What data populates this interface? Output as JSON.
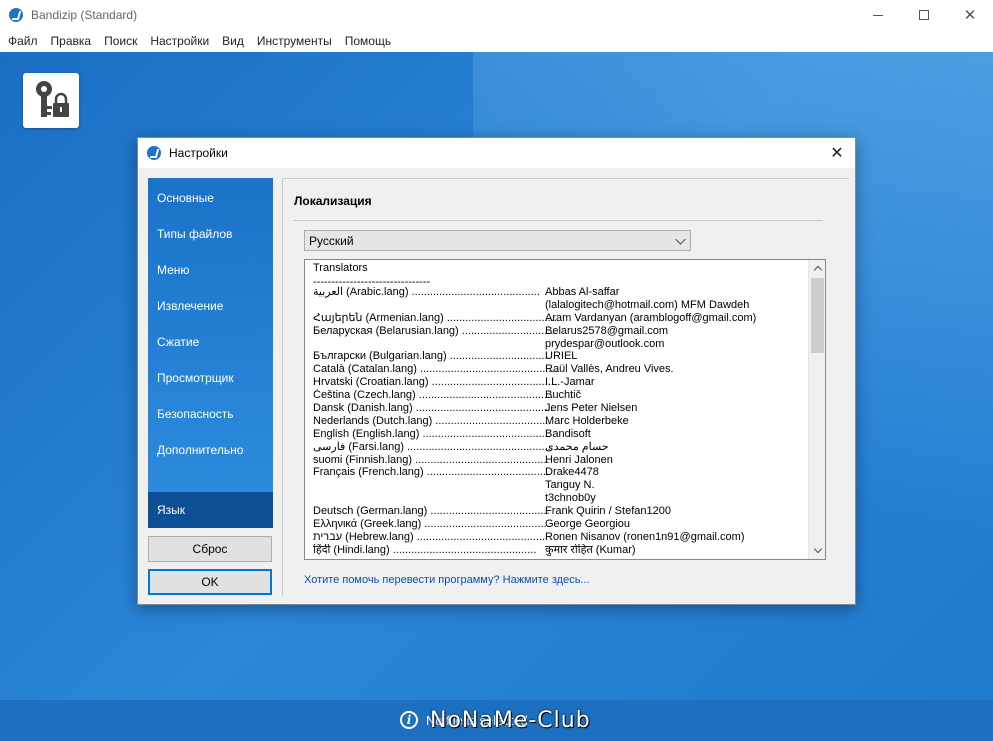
{
  "app": {
    "title": "Bandizip (Standard)"
  },
  "menu": [
    "Файл",
    "Правка",
    "Поиск",
    "Настройки",
    "Вид",
    "Инструменты",
    "Помощь"
  ],
  "dialog": {
    "title": "Настройки",
    "sidebar": [
      "Основные",
      "Типы файлов",
      "Меню",
      "Извлечение",
      "Сжатие",
      "Просмотрщик",
      "Безопасность",
      "Дополнительно",
      "Язык"
    ],
    "active_item": "Язык",
    "reset_label": "Сброс",
    "ok_label": "OK",
    "panel_title": "Локализация",
    "language_value": "Русский",
    "translators_header": "Translators",
    "translators_dashes": "--------------------------------",
    "translators": [
      {
        "lang": "العربية (Arabic.lang) ..........................................",
        "name": "Abbas Al-saffar"
      },
      {
        "lang": "",
        "name": "(lalalogitech@hotmail.com) MFM Dawdeh"
      },
      {
        "lang": "Հայերեն (Armenian.lang) ....................................",
        "name": "Aram Vardanyan (aramblogoff@gmail.com)"
      },
      {
        "lang": "Беларуская (Belarusian.lang) ...............................",
        "name": "Belarus2578@gmail.com"
      },
      {
        "lang": "",
        "name": "prydespar@outlook.com"
      },
      {
        "lang": "Български (Bulgarian.lang) .................................",
        "name": "URIEL"
      },
      {
        "lang": "Català (Catalan.lang) .............................................",
        "name": "Raül Vallès, Andreu Vives."
      },
      {
        "lang": "Hrvatski (Croatian.lang) .........................................",
        "name": "I.L.-Jamar"
      },
      {
        "lang": "Čeština (Czech.lang) ............................................",
        "name": "Buchtič"
      },
      {
        "lang": "Dansk (Danish.lang) .............................................",
        "name": "Jens Peter Nielsen"
      },
      {
        "lang": "Nederlands (Dutch.lang) ......................................",
        "name": "Marc Holderbeke"
      },
      {
        "lang": "English (English.lang) ..........................................",
        "name": "Bandisoft"
      },
      {
        "lang": "فارسی (Farsi.lang) ...............................................",
        "name": "حسام محمدی"
      },
      {
        "lang": "suomi (Finnish.lang) ............................................",
        "name": "Henri Jalonen"
      },
      {
        "lang": "Français (French.lang) ........................................",
        "name": "Drake4478"
      },
      {
        "lang": "",
        "name": "Tanguy N."
      },
      {
        "lang": "",
        "name": "t3chnob0y"
      },
      {
        "lang": "Deutsch (German.lang) .......................................",
        "name": "Frank Quirin / Stefan1200"
      },
      {
        "lang": "Ελληνικά (Greek.lang) .........................................",
        "name": "George Georgiou"
      },
      {
        "lang": "עברית (Hebrew.lang) ..........................................",
        "name": "Ronen Nisanov (ronen1n91@gmail.com)"
      },
      {
        "lang": "हिंदी (Hindi.lang) ...............................................",
        "name": "कुमार रोहित (Kumar)"
      }
    ],
    "help_link": "Хотите помочь перевести программу? Нажмите здесь..."
  },
  "status": {
    "text": "No file is selected",
    "watermark": "NoNaMe-Club"
  }
}
